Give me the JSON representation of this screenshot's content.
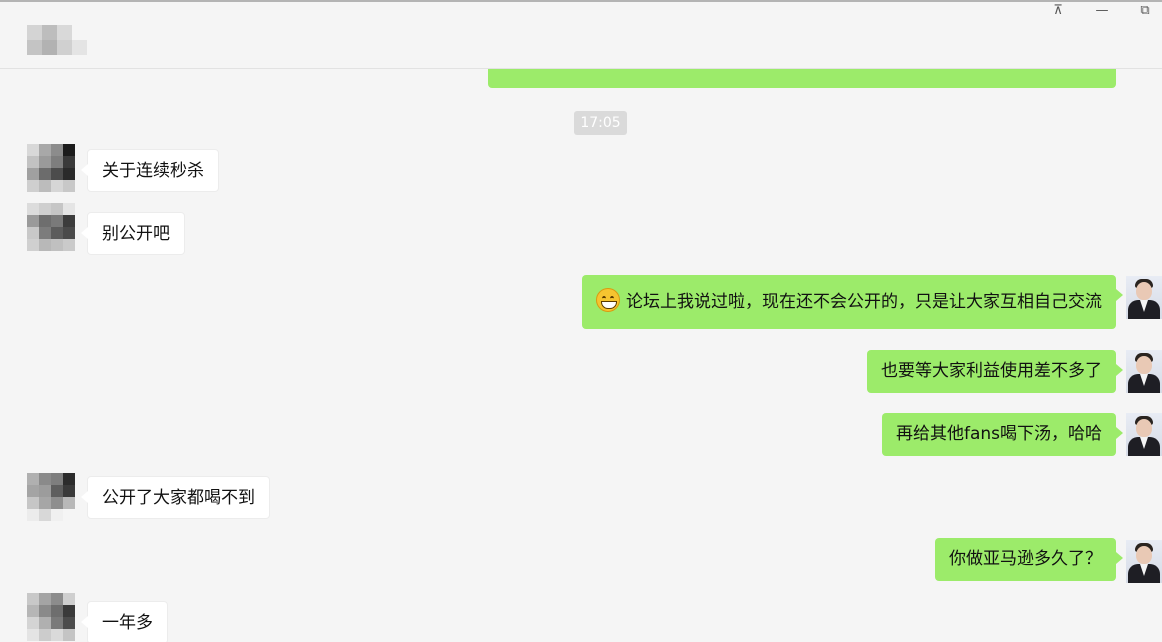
{
  "window": {
    "pin_label": "⊼",
    "minimize_label": "—",
    "restore_label": "⧉"
  },
  "timestamp": "17:05",
  "messages": [
    {
      "side": "out",
      "text": "…",
      "partial": true
    },
    {
      "side": "in",
      "text": "关于连续秒杀"
    },
    {
      "side": "in",
      "text": "别公开吧"
    },
    {
      "side": "out",
      "text": "论坛上我说过啦，现在还不会公开的，只是让大家互相自己交流",
      "emoji": "grinning-emoji"
    },
    {
      "side": "out",
      "text": "也要等大家利益使用差不多了"
    },
    {
      "side": "out",
      "text": "再给其他fans喝下汤，哈哈"
    },
    {
      "side": "in",
      "text": "公开了大家都喝不到"
    },
    {
      "side": "out",
      "text": "你做亚马逊多久了？"
    },
    {
      "side": "in",
      "text": "一年多"
    }
  ],
  "colors": {
    "background": "#f5f5f5",
    "outgoing_bubble": "#9ceb6a",
    "incoming_bubble": "#ffffff",
    "timestamp_bg": "#dadada"
  }
}
